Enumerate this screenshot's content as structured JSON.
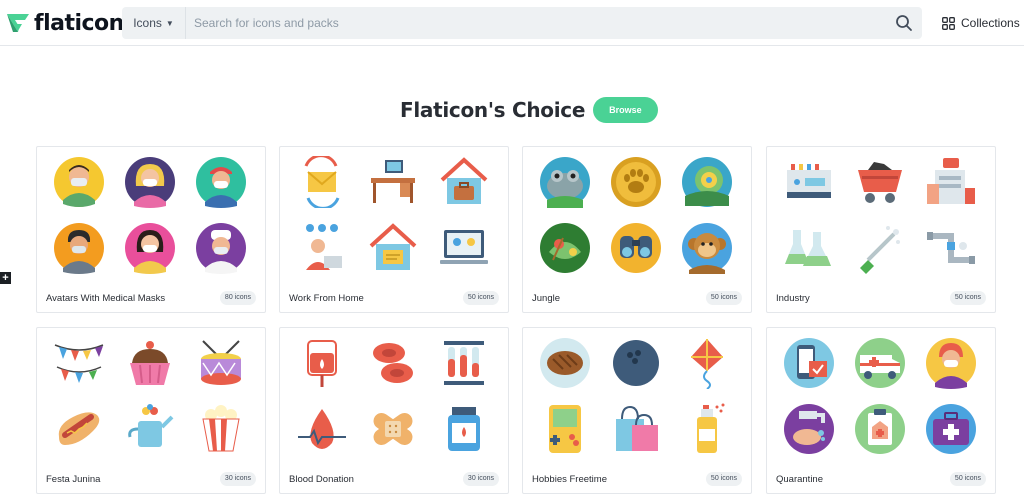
{
  "header": {
    "logo_text": "flaticon",
    "search_type": "Icons",
    "search_placeholder": "Search for icons and packs",
    "collections_label": "Collections",
    "side_button": "+"
  },
  "section": {
    "title": "Flaticon's Choice",
    "browse_label": "Browse"
  },
  "colors": {
    "brand_green": "#4ad295",
    "text_dark": "#292d34",
    "search_bg": "#eef1f3"
  },
  "packs": [
    {
      "title": "Avatars With Medical Masks",
      "count": "80 icons",
      "icons": [
        "doctor-mask-avatar-icon",
        "woman-mask-avatar-icon",
        "nurse-mask-avatar-icon",
        "man-mask-avatar-icon",
        "girl-mask-avatar-icon",
        "chef-mask-avatar-icon"
      ]
    },
    {
      "title": "Work From Home",
      "count": "50 icons",
      "icons": [
        "email-sync-icon",
        "desk-computer-icon",
        "home-briefcase-icon",
        "video-call-icon",
        "home-document-icon",
        "laptop-meeting-icon"
      ]
    },
    {
      "title": "Jungle",
      "count": "50 icons",
      "icons": [
        "frog-icon",
        "animal-print-icon",
        "chameleon-icon",
        "jungle-bird-icon",
        "binoculars-icon",
        "monkey-icon"
      ]
    },
    {
      "title": "Industry",
      "count": "50 icons",
      "icons": [
        "control-panel-icon",
        "mine-cart-icon",
        "factory-icon",
        "flask-icon",
        "screwdriver-icon",
        "pipes-icon"
      ]
    },
    {
      "title": "Festa Junina",
      "count": "30 icons",
      "icons": [
        "bunting-flags-icon",
        "cupcake-icon",
        "drum-icon",
        "hot-dog-icon",
        "watering-can-icon",
        "popcorn-icon"
      ]
    },
    {
      "title": "Blood Donation",
      "count": "30 icons",
      "icons": [
        "blood-bag-icon",
        "blood-cells-icon",
        "test-tubes-icon",
        "blood-drop-icon",
        "bandage-icon",
        "blood-jar-icon"
      ]
    },
    {
      "title": "Hobbies Freetime",
      "count": "50 icons",
      "icons": [
        "steak-icon",
        "bowling-ball-icon",
        "kite-icon",
        "gameboy-icon",
        "shopping-bags-icon",
        "spray-paint-icon"
      ]
    },
    {
      "title": "Quarantine",
      "count": "50 icons",
      "icons": [
        "phone-shopping-icon",
        "ambulance-icon",
        "doctor-icon",
        "washing-hands-icon",
        "medical-clipboard-icon",
        "first-aid-kit-icon"
      ]
    }
  ]
}
